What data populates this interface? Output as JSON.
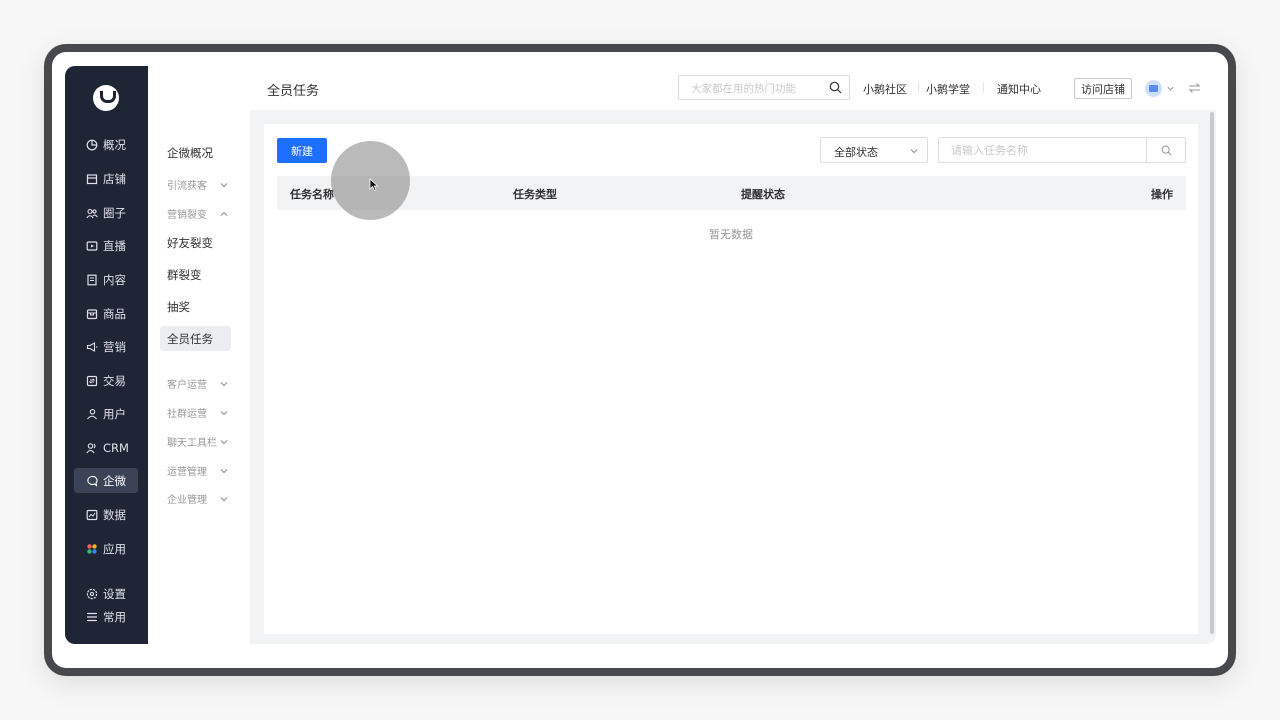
{
  "sidebar": {
    "items": [
      {
        "label": "概况",
        "icon": "pie-chart-icon"
      },
      {
        "label": "店铺",
        "icon": "store-icon"
      },
      {
        "label": "圈子",
        "icon": "people-icon"
      },
      {
        "label": "直播",
        "icon": "live-icon"
      },
      {
        "label": "内容",
        "icon": "document-icon"
      },
      {
        "label": "商品",
        "icon": "box-icon"
      },
      {
        "label": "营销",
        "icon": "megaphone-icon"
      },
      {
        "label": "交易",
        "icon": "trade-icon"
      },
      {
        "label": "用户",
        "icon": "user-icon"
      },
      {
        "label": "CRM",
        "icon": "crm-icon"
      },
      {
        "label": "企微",
        "icon": "wecom-icon",
        "active": true
      },
      {
        "label": "数据",
        "icon": "data-icon"
      },
      {
        "label": "应用",
        "icon": "apps-icon"
      }
    ],
    "bottom": [
      {
        "label": "设置",
        "icon": "gear-icon"
      },
      {
        "label": "常用",
        "icon": "list-icon"
      }
    ]
  },
  "subnav": {
    "overview": "企微概况",
    "groups": {
      "lead": "引流获客",
      "fission": "营销裂变",
      "customer": "客户运营",
      "community": "社群运营",
      "chat_toolbar": "聊天工具栏",
      "operations": "运营管理",
      "enterprise": "企业管理"
    },
    "fission_items": [
      "好友裂变",
      "群裂变",
      "抽奖",
      "全员任务"
    ]
  },
  "topbar": {
    "title": "全员任务",
    "search_placeholder": "大家都在用的热门功能",
    "links": [
      "小鹅社区",
      "小鹅学堂",
      "通知中心"
    ],
    "visit_store": "访问店铺"
  },
  "content": {
    "new_button": "新建",
    "status_select": "全部状态",
    "search_placeholder": "请输入任务名称",
    "columns": [
      "任务名称",
      "任务类型",
      "提醒状态",
      "操作"
    ],
    "empty": "暂无数据"
  },
  "colors": {
    "sidebar_bg": "#1e2534",
    "primary": "#1f6fff"
  }
}
